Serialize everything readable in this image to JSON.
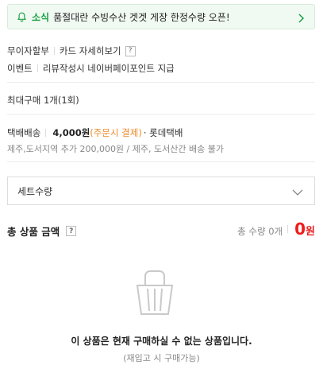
{
  "notice": {
    "tag": "소식",
    "text": "품절대란 수빙수산 겟겟 게장 한정수량 오픈!",
    "icon": "bell-icon",
    "accent": "#17a043"
  },
  "benefits": {
    "interest_free": "무이자할부",
    "card_detail": "카드 자세히보기",
    "event_label": "이벤트",
    "event_text": "리뷰작성시 네이버페이포인트 지급"
  },
  "purchase_limit": "최대구매 1개(1회)",
  "shipping": {
    "label": "택배배송",
    "price": "4,000원",
    "condition": "(주문시 결제)",
    "carrier": "· 롯데택배",
    "extra": "제주,도서지역 추가 200,000원 / 제주, 도서산간 배송 불가"
  },
  "option_select": {
    "label": "세트수량"
  },
  "total": {
    "label": "총 상품 금액",
    "count_text": "총 수량 0개",
    "amount": "0",
    "unit": "원",
    "amount_color": "#f01c1c"
  },
  "empty": {
    "message": "이 상품은 현재 구매하실 수 없는 상품입니다.",
    "sub": "(재입고 시 구매가능)"
  }
}
